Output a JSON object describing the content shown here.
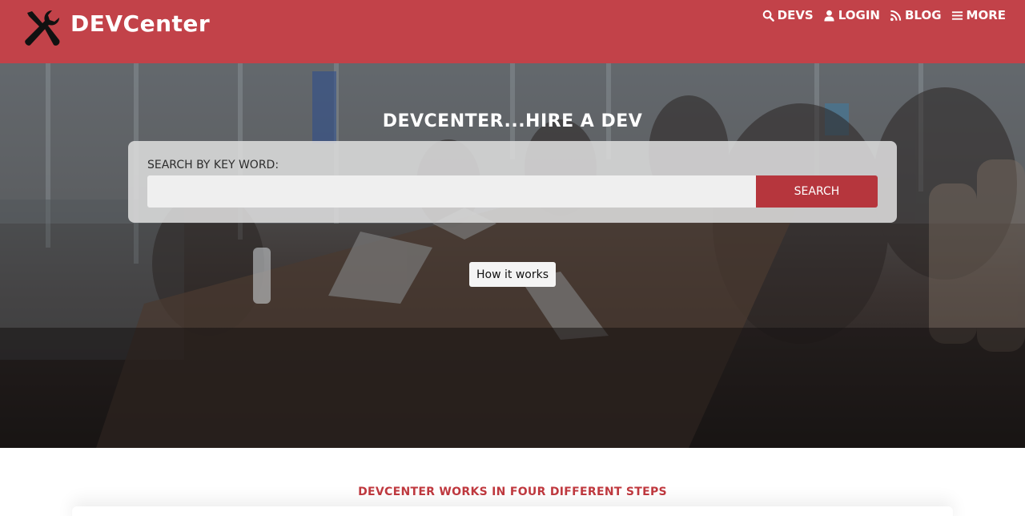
{
  "header": {
    "brand": "DEVCenter",
    "nav": [
      {
        "label": "DEVS",
        "icon": "search-icon"
      },
      {
        "label": "LOGIN",
        "icon": "user-icon"
      },
      {
        "label": "BLOG",
        "icon": "rss-icon"
      },
      {
        "label": "MORE",
        "icon": "menu-icon"
      }
    ],
    "colors": {
      "header_bg": "#c24249",
      "accent": "#b6363d"
    }
  },
  "hero": {
    "title": "DEVCENTER...HIRE A DEV",
    "search": {
      "label": "SEARCH BY KEY WORD:",
      "value": "",
      "button_label": "SEARCH"
    },
    "how_it_works_label": "How it works"
  },
  "steps": {
    "title": "DEVCENTER WORKS IN FOUR DIFFERENT STEPS"
  }
}
